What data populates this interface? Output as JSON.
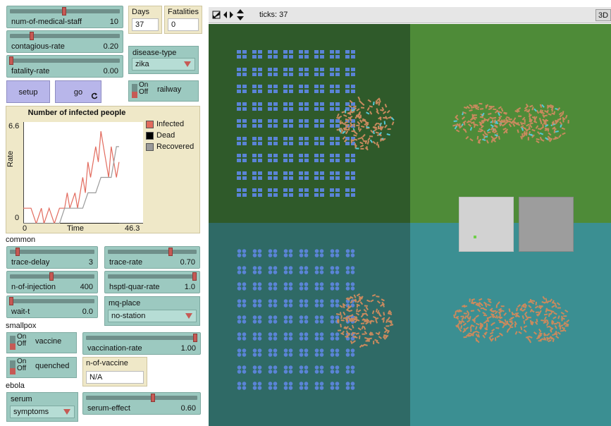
{
  "controls": {
    "medical_staff": {
      "label": "num-of-medical-staff",
      "value": "10",
      "level": 0.5
    },
    "contagious_rate": {
      "label": "contagious-rate",
      "value": "0.20",
      "level": 0.2
    },
    "fatality_rate": {
      "label": "fatality-rate",
      "value": "0.00",
      "level": 0.0
    },
    "days": {
      "label": "Days",
      "value": "37"
    },
    "fatalities": {
      "label": "Fatalities",
      "value": "0"
    },
    "disease_type": {
      "label": "disease-type",
      "value": "zika"
    },
    "setup_label": "setup",
    "go_label": "go",
    "go_icon": "forever-icon",
    "railway": {
      "label": "railway",
      "on": "On",
      "off": "Off"
    }
  },
  "plot": {
    "title": "Number of infected people",
    "ylabel": "Rate",
    "xlabel": "Time",
    "ymax_label": "6.6",
    "ymin_label": "0",
    "xmin_label": "0",
    "xmax_label": "46.3",
    "legend": [
      {
        "name": "Infected",
        "color": "#e26b5e"
      },
      {
        "name": "Dead",
        "color": "#000000"
      },
      {
        "name": "Recovered",
        "color": "#9a9a9a"
      }
    ]
  },
  "chart_data": {
    "type": "line",
    "title": "Number of infected people",
    "xlabel": "Time",
    "ylabel": "Rate",
    "xlim": [
      0,
      46.3
    ],
    "ylim": [
      0,
      6.6
    ],
    "series": [
      {
        "name": "Infected",
        "color": "#e26b5e",
        "x": [
          0,
          3,
          5,
          7,
          8,
          10,
          12,
          14,
          16,
          17,
          18,
          20,
          21,
          22,
          23,
          24,
          25,
          26,
          28,
          29,
          30,
          31,
          32,
          33,
          34,
          35,
          36,
          37
        ],
        "y": [
          1,
          1,
          0,
          1,
          0,
          1,
          0,
          1,
          1,
          2,
          1,
          2,
          1,
          2,
          3,
          2,
          4,
          3,
          5,
          4,
          6,
          5,
          4,
          3,
          5,
          4,
          3,
          4
        ]
      },
      {
        "name": "Dead",
        "color": "#000000",
        "x": [
          0,
          37
        ],
        "y": [
          0,
          0
        ]
      },
      {
        "name": "Recovered",
        "color": "#9a9a9a",
        "x": [
          0,
          14,
          16,
          20,
          23,
          25,
          28,
          30,
          32,
          34,
          35,
          36,
          37
        ],
        "y": [
          0,
          0,
          1,
          1,
          1,
          2,
          2,
          3,
          3,
          3,
          4,
          5,
          5
        ]
      }
    ]
  },
  "common": {
    "section_label": "common",
    "trace_delay": {
      "label": "trace-delay",
      "value": "3",
      "level": 0.1
    },
    "trace_rate": {
      "label": "trace-rate",
      "value": "0.70",
      "level": 0.7
    },
    "n_of_injection": {
      "label": "n-of-injection",
      "value": "400",
      "level": 0.4
    },
    "hsptl_quar_rate": {
      "label": "hsptl-quar-rate",
      "value": "1.0",
      "level": 1.0
    },
    "wait_t": {
      "label": "wait-t",
      "value": "0.0",
      "level": 0.0
    },
    "mq_place": {
      "label": "mq-place",
      "value": "no-station"
    }
  },
  "smallpox": {
    "section_label": "smallpox",
    "vaccine": {
      "label": "vaccine",
      "on": "On",
      "off": "Off"
    },
    "quenched": {
      "label": "quenched",
      "on": "On",
      "off": "Off"
    },
    "vaccination_rate": {
      "label": "vaccination-rate",
      "value": "1.00",
      "level": 1.0
    },
    "n_of_vaccine": {
      "label": "n-of-vaccine",
      "value": "N/A"
    }
  },
  "ebola": {
    "section_label": "ebola",
    "serum": {
      "label": "serum",
      "value": "symptoms"
    },
    "serum_effect": {
      "label": "serum-effect",
      "value": "0.60",
      "level": 0.6
    }
  },
  "world": {
    "ticks_label": "ticks: 37",
    "view_3d_label": "3D",
    "colors": {
      "top_left": "#2f5a2a",
      "top_right": "#4e8b38",
      "bottom_left": "#2f6a66",
      "bottom_right": "#3b8f92",
      "house": "#5a84d6",
      "person": "#c98a5e",
      "infected": "#55c8d8"
    }
  }
}
